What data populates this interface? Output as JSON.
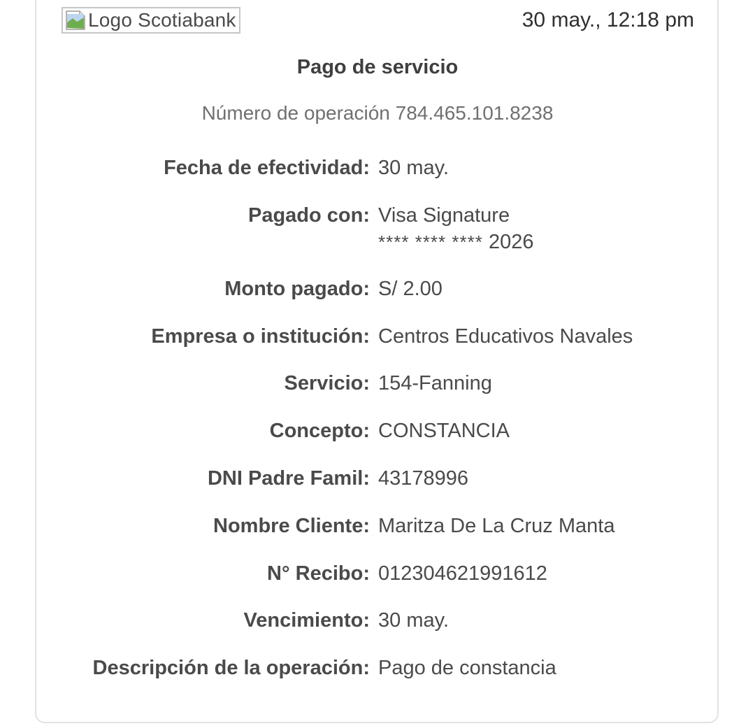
{
  "header": {
    "logo_alt": "Logo Scotiabank",
    "timestamp": "30 may., 12:18 pm"
  },
  "receipt": {
    "title": "Pago de servicio",
    "operation_label": "Número de operación 784.465.101.8238"
  },
  "rows": [
    {
      "label": "Fecha de efectividad:",
      "value": "30 may."
    },
    {
      "label": "Pagado con:",
      "value": "Visa Signature",
      "value_line2_stars": "**** **** ****",
      "value_line2_digits": "2026"
    },
    {
      "label": "Monto pagado:",
      "value": "S/ 2.00"
    },
    {
      "label": "Empresa o institución:",
      "value": "Centros Educativos Navales"
    },
    {
      "label": "Servicio:",
      "value": "154-Fanning"
    },
    {
      "label": "Concepto:",
      "value": "CONSTANCIA"
    },
    {
      "label": "DNI Padre Famil:",
      "value": "43178996"
    },
    {
      "label": "Nombre Cliente:",
      "value": "Maritza De La Cruz Manta"
    },
    {
      "label": "N° Recibo:",
      "value": "012304621991612"
    },
    {
      "label": "Vencimiento:",
      "value": "30 may."
    },
    {
      "label": "Descripción de la operación:",
      "value": "Pago de constancia"
    }
  ],
  "colors": {
    "label_text": "#4a4a4a",
    "muted_text": "#707070",
    "card_border": "#e2e2e2"
  }
}
